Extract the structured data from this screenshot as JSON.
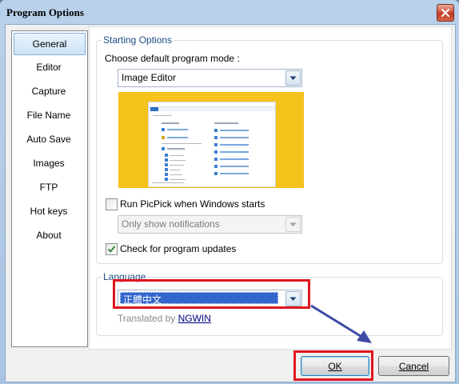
{
  "window": {
    "title": "Program Options"
  },
  "sidebar": {
    "items": [
      {
        "label": "General",
        "selected": true
      },
      {
        "label": "Editor"
      },
      {
        "label": "Capture"
      },
      {
        "label": "File Name"
      },
      {
        "label": "Auto Save"
      },
      {
        "label": "Images"
      },
      {
        "label": "FTP"
      },
      {
        "label": "Hot keys"
      },
      {
        "label": "About"
      }
    ]
  },
  "starting_options": {
    "group_title": "Starting Options",
    "mode_label": "Choose default program mode :",
    "mode_value": "Image Editor",
    "run_on_start": {
      "label": "Run PicPick when Windows starts",
      "checked": false
    },
    "notify_value": "Only show notifications",
    "check_updates": {
      "label": "Check for program updates",
      "checked": true
    }
  },
  "language": {
    "group_title": "Language",
    "value": "正體中文",
    "translated_by_prefix": "Translated by ",
    "translator": "NGWIN"
  },
  "buttons": {
    "ok": "OK",
    "cancel": "Cancel"
  },
  "colors": {
    "accent": "#3366cc",
    "highlight": "#e0161e",
    "arrow": "#3d4ba3",
    "preview_bg": "#f6c21c"
  }
}
